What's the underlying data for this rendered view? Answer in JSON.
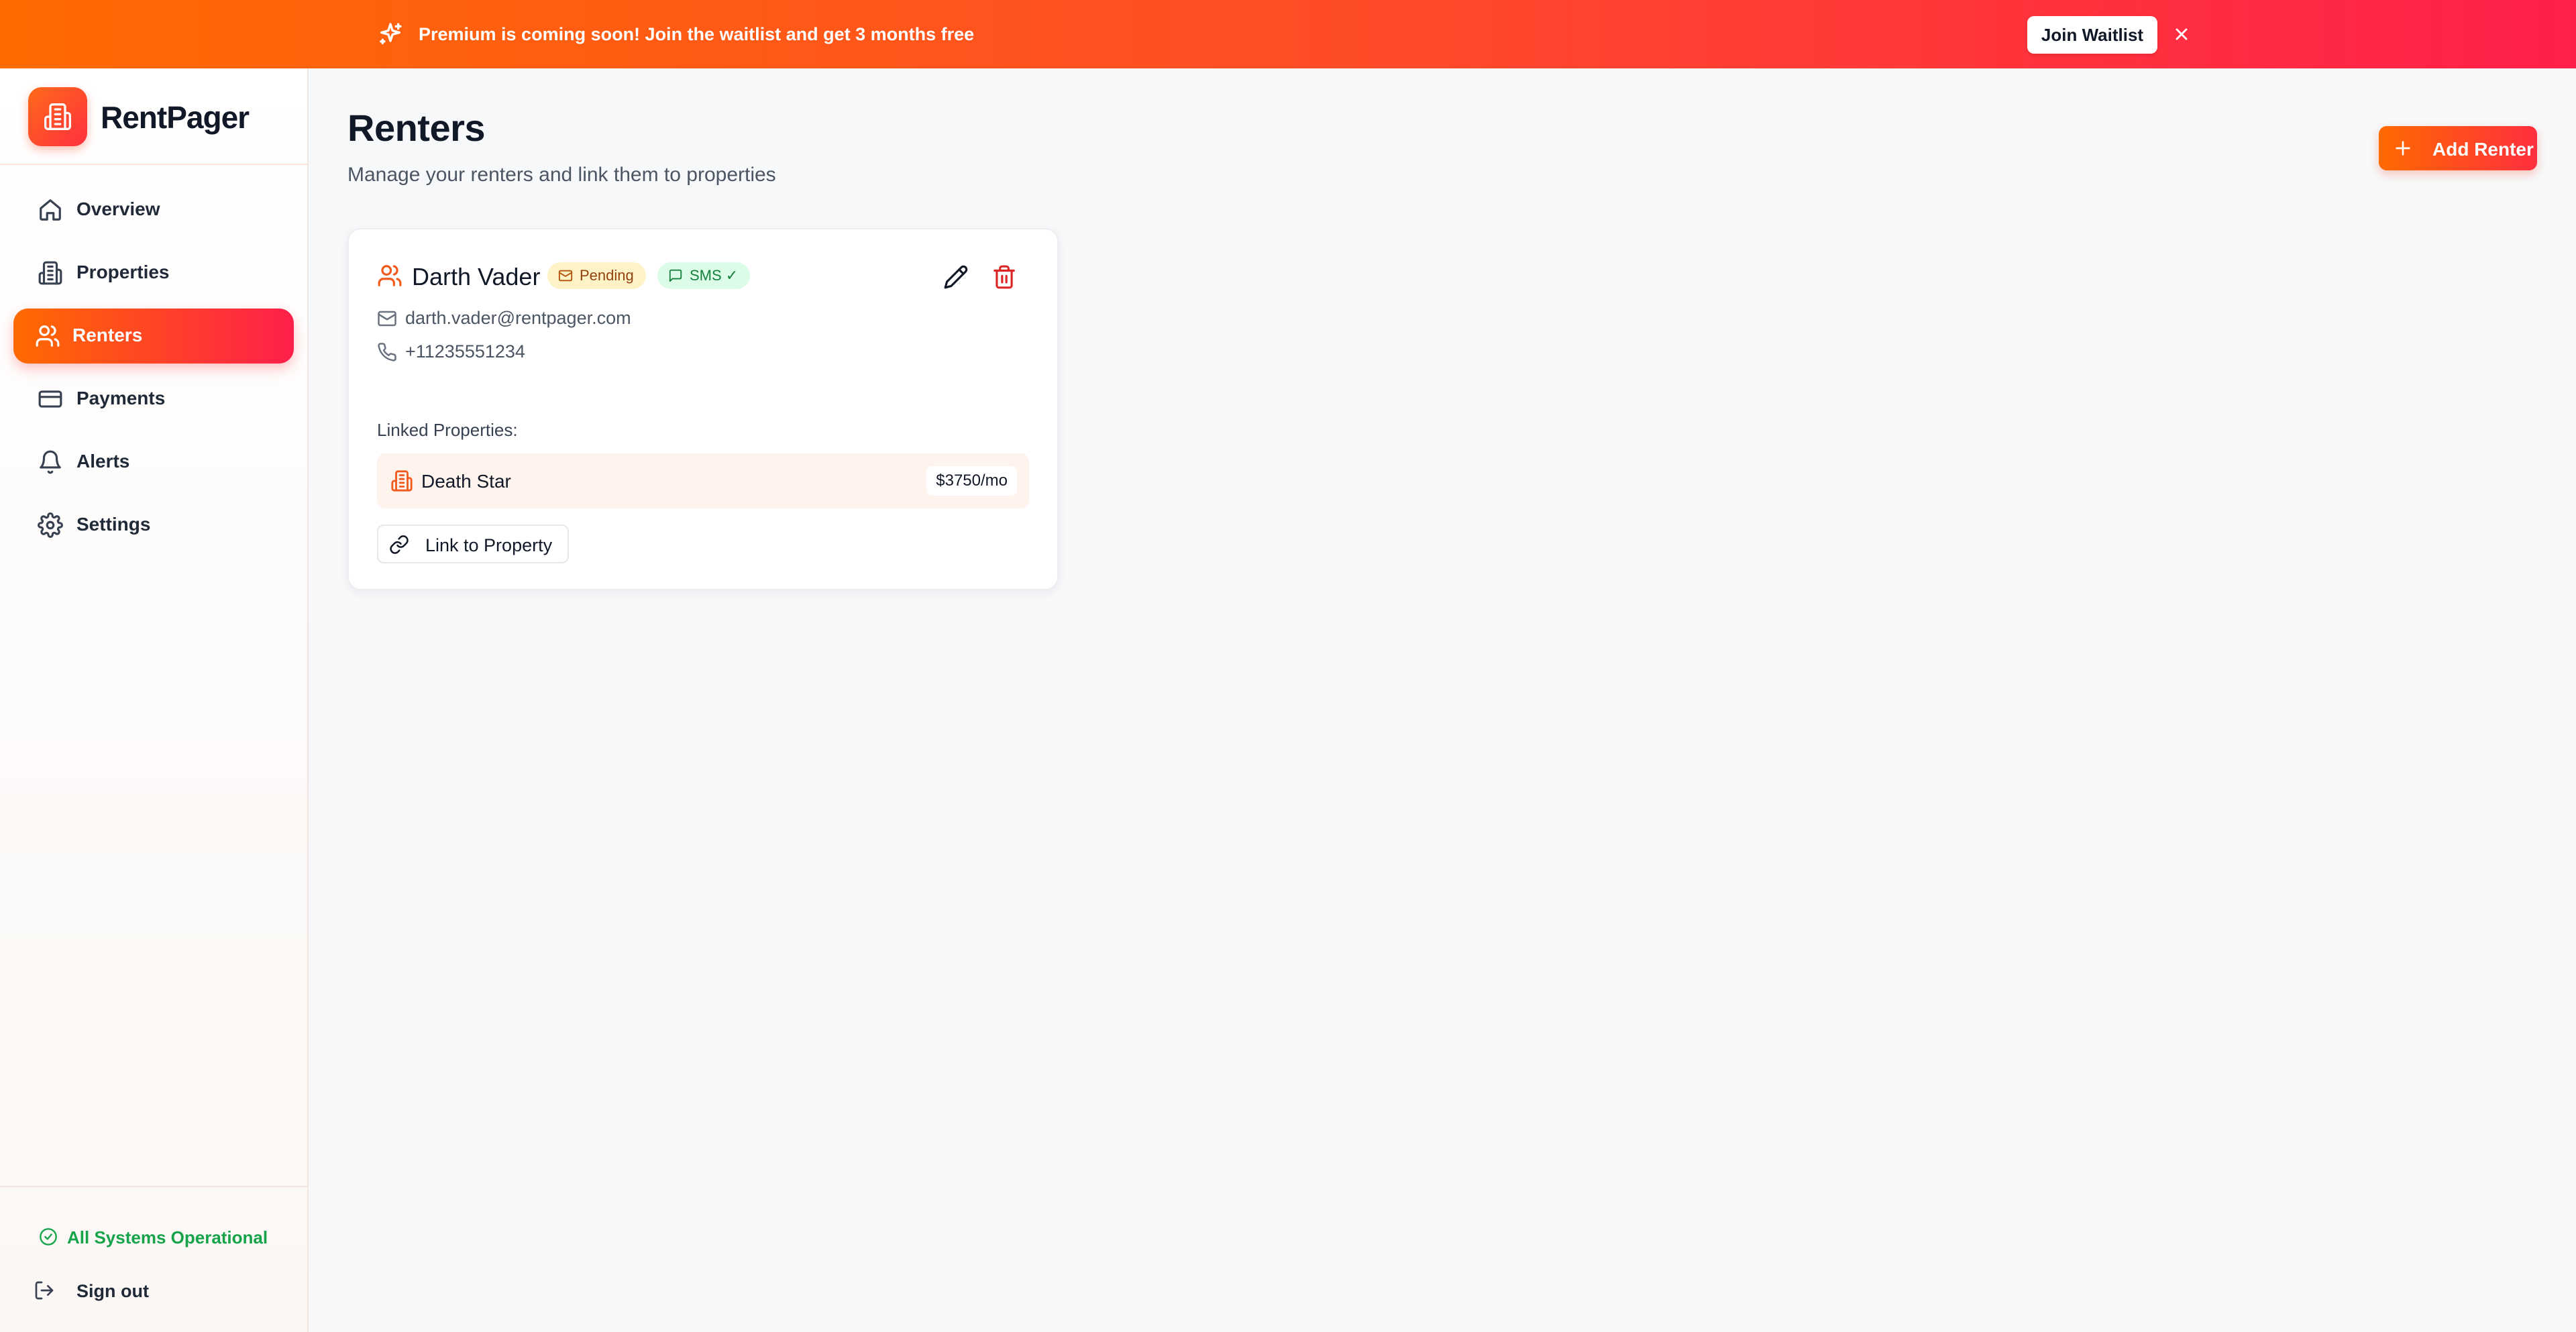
{
  "banner": {
    "text": "Premium is coming soon! Join the waitlist and get ",
    "highlight": "3 months free",
    "button_label": "Join Waitlist",
    "icons": {
      "sparkle": "sparkle-icon",
      "close": "close-icon"
    }
  },
  "brand": {
    "name": "RentPager",
    "logo_icon": "building-icon"
  },
  "sidebar": {
    "items": [
      {
        "label": "Overview",
        "icon": "home-icon",
        "active": false
      },
      {
        "label": "Properties",
        "icon": "building-icon",
        "active": false
      },
      {
        "label": "Renters",
        "icon": "users-icon",
        "active": true
      },
      {
        "label": "Payments",
        "icon": "credit-card-icon",
        "active": false
      },
      {
        "label": "Alerts",
        "icon": "bell-icon",
        "active": false
      },
      {
        "label": "Settings",
        "icon": "gear-icon",
        "active": false
      }
    ],
    "status": "All Systems Operational",
    "sign_out": "Sign out"
  },
  "page": {
    "title": "Renters",
    "subtitle": "Manage your renters and link them to properties",
    "add_button": "Add Renter"
  },
  "renters": [
    {
      "name": "Darth Vader",
      "email_status": "Pending",
      "sms_status": "SMS ✓",
      "email": "darth.vader@rentpager.com",
      "phone": "+11235551234",
      "linked_label": "Linked Properties:",
      "properties": [
        {
          "name": "Death Star",
          "rent": "$3750/mo"
        }
      ],
      "link_button": "Link to Property"
    }
  ],
  "colors": {
    "accent_start": "#ff6a00",
    "accent_end": "#ff1f4b",
    "success": "#16a34a",
    "pending_bg": "#fef3c7",
    "sms_bg": "#dcfce7"
  }
}
